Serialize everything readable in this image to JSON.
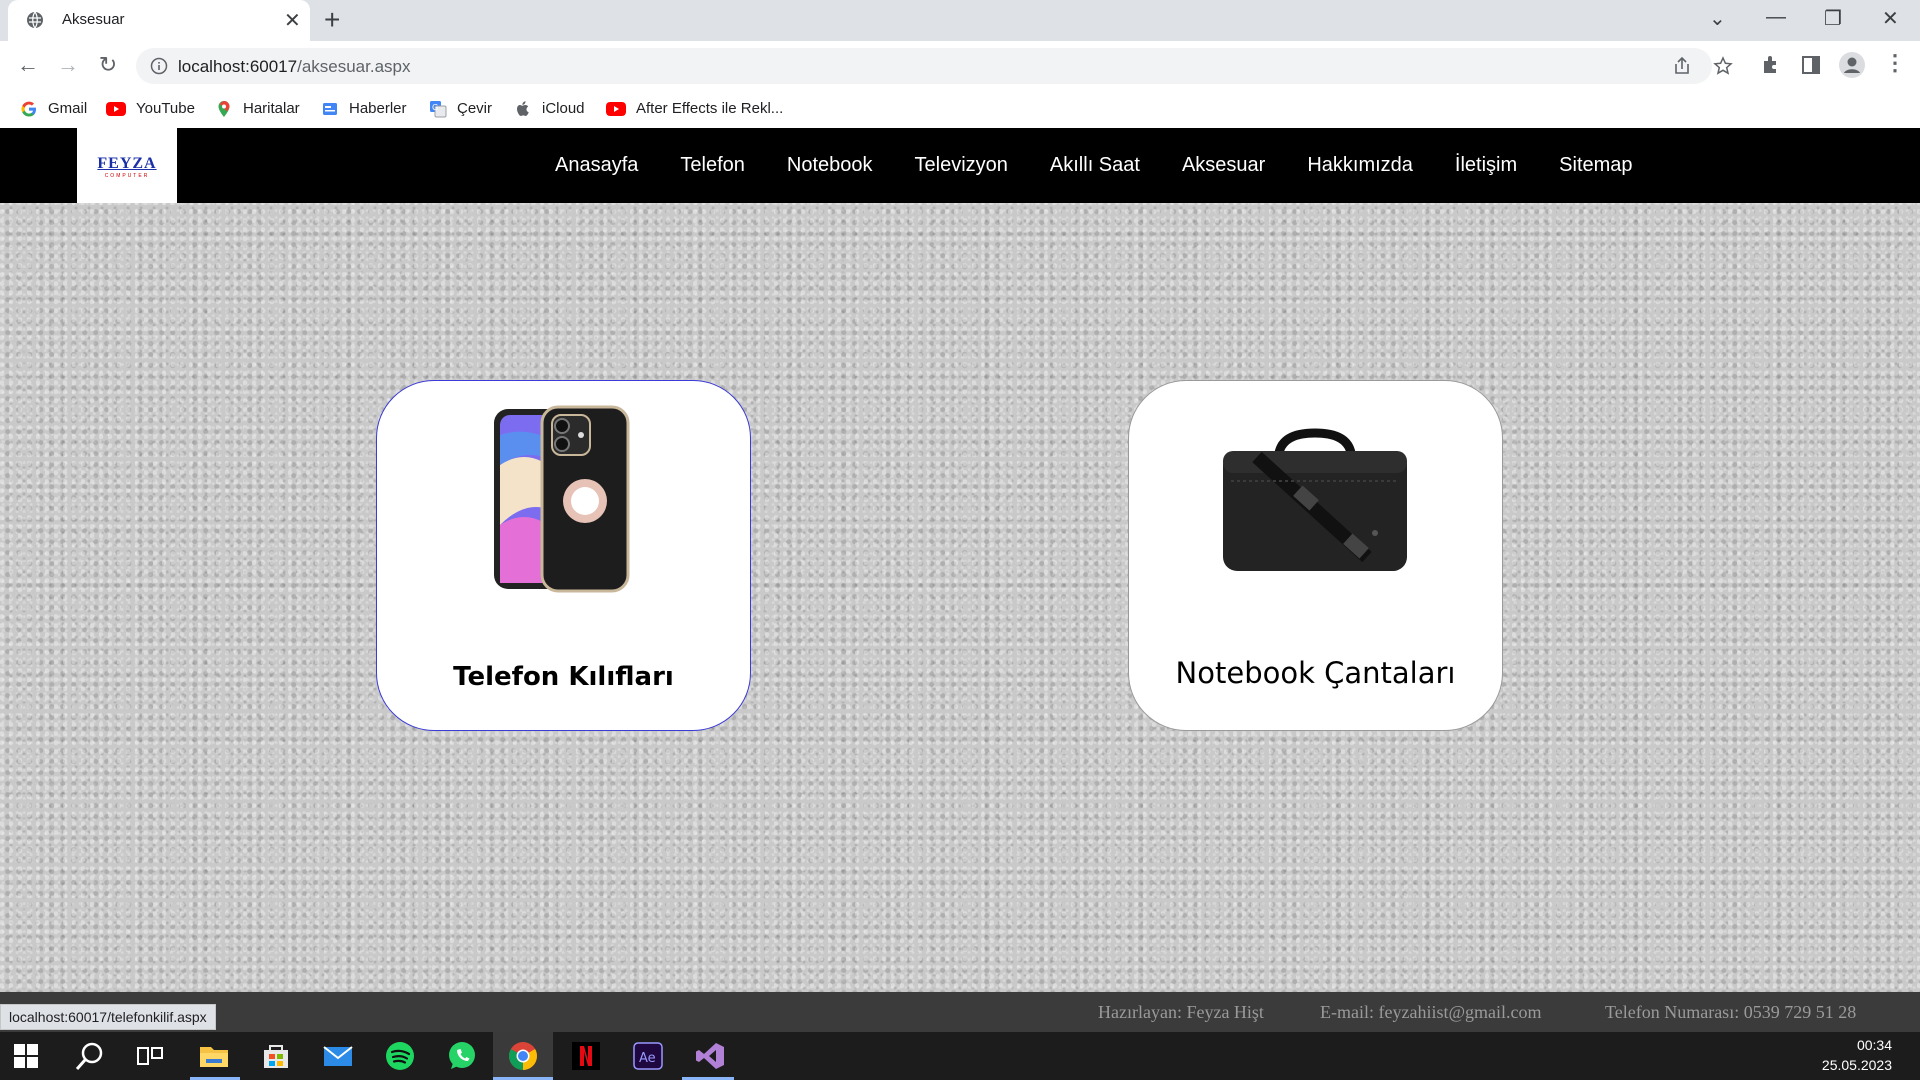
{
  "browser": {
    "tab_title": "Aksesuar",
    "url_host": "localhost:60017",
    "url_path": "/aksesuar.aspx",
    "bookmarks": [
      "Gmail",
      "YouTube",
      "Haritalar",
      "Haberler",
      "Çevir",
      "iCloud",
      "After Effects ile Rekl..."
    ]
  },
  "site": {
    "logo_text": "FEYZA",
    "logo_sub": "COMPUTER",
    "menu": [
      "Anasayfa",
      "Telefon",
      "Notebook",
      "Televizyon",
      "Akıllı Saat",
      "Aksesuar",
      "Hakkımızda",
      "İletişim",
      "Sitemap"
    ],
    "cards": {
      "phone": "Telefon Kılıfları",
      "bag": "Notebook Çantaları"
    },
    "footer": {
      "author": "Hazırlayan: Feyza Hişt",
      "email": "E-mail: feyzahiist@gmail.com",
      "phone": "Telefon Numarası: 0539 729 51 28"
    }
  },
  "status_url": "localhost:60017/telefonkilif.aspx",
  "taskbar": {
    "time": "00:34",
    "date": "25.05.2023"
  },
  "colors": {
    "header_bg": "#000000",
    "phone_card_border": "#3b3bd6",
    "footer_bg": "#3b3b3b"
  }
}
